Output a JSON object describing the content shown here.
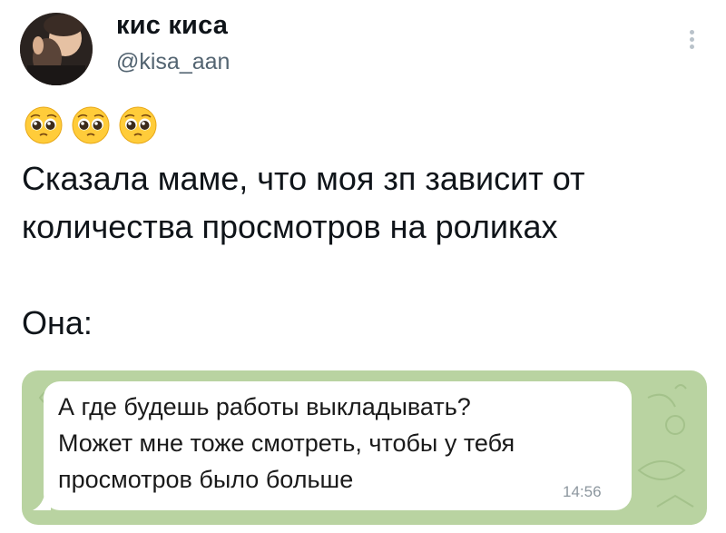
{
  "author": {
    "display_name": "кис киса",
    "handle": "@kisa_aan",
    "avatar_icon": "user-avatar"
  },
  "menu": {
    "icon": "more-vertical-icon"
  },
  "tweet": {
    "emoji": [
      "pleading-face-emoji",
      "pleading-face-emoji",
      "pleading-face-emoji"
    ],
    "lines": [
      "Сказала маме, что моя зп зависит от",
      "количества просмотров на роликах",
      "Она:"
    ]
  },
  "chat_message": {
    "lines": [
      "А где будешь работы выкладывать?",
      "Может мне тоже смотреть, чтобы у тебя",
      "просмотров было больше"
    ],
    "time": "14:56"
  },
  "colors": {
    "chat_background": "#b9d3a1",
    "bubble": "#ffffff",
    "handle_text": "#536471",
    "time_text": "#8c969e"
  }
}
